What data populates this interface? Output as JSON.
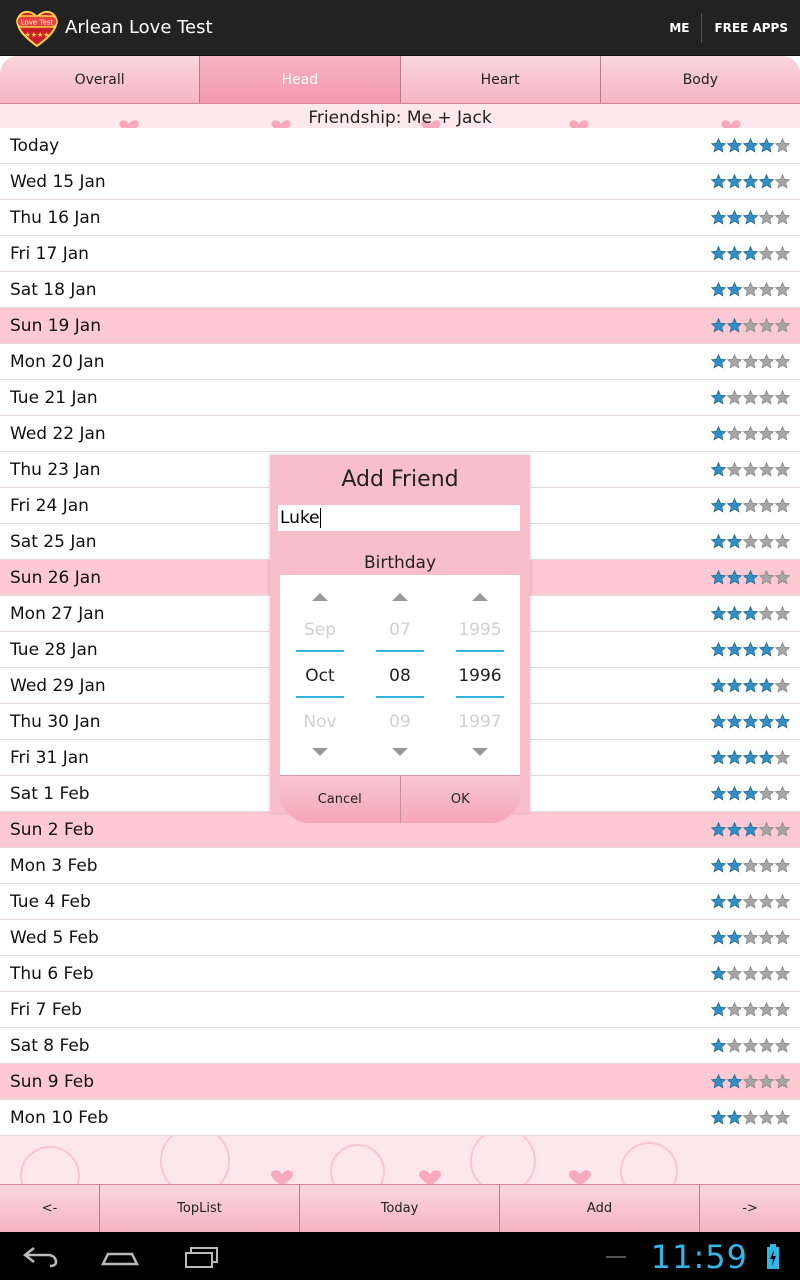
{
  "app": {
    "title": "Arlean Love Test",
    "logo_text": "Love Test",
    "actions": [
      "ME",
      "FREE APPS"
    ]
  },
  "tabs": [
    {
      "label": "Overall",
      "active": false
    },
    {
      "label": "Head",
      "active": true
    },
    {
      "label": "Heart",
      "active": false
    },
    {
      "label": "Body",
      "active": false
    }
  ],
  "banner": {
    "text": "Friendship: Me + Jack"
  },
  "rows": [
    {
      "date": "Today",
      "stars": 4,
      "weekend": false
    },
    {
      "date": "Wed 15 Jan",
      "stars": 4,
      "weekend": false
    },
    {
      "date": "Thu 16 Jan",
      "stars": 3,
      "weekend": false
    },
    {
      "date": "Fri 17 Jan",
      "stars": 3,
      "weekend": false
    },
    {
      "date": "Sat 18 Jan",
      "stars": 2,
      "weekend": false
    },
    {
      "date": "Sun 19 Jan",
      "stars": 2,
      "weekend": true
    },
    {
      "date": "Mon 20 Jan",
      "stars": 1,
      "weekend": false
    },
    {
      "date": "Tue 21 Jan",
      "stars": 1,
      "weekend": false
    },
    {
      "date": "Wed 22 Jan",
      "stars": 1,
      "weekend": false
    },
    {
      "date": "Thu 23 Jan",
      "stars": 1,
      "weekend": false
    },
    {
      "date": "Fri 24 Jan",
      "stars": 2,
      "weekend": false
    },
    {
      "date": "Sat 25 Jan",
      "stars": 2,
      "weekend": false
    },
    {
      "date": "Sun 26 Jan",
      "stars": 3,
      "weekend": true
    },
    {
      "date": "Mon 27 Jan",
      "stars": 3,
      "weekend": false
    },
    {
      "date": "Tue 28 Jan",
      "stars": 4,
      "weekend": false
    },
    {
      "date": "Wed 29 Jan",
      "stars": 4,
      "weekend": false
    },
    {
      "date": "Thu 30 Jan",
      "stars": 5,
      "weekend": false
    },
    {
      "date": "Fri 31 Jan",
      "stars": 4,
      "weekend": false
    },
    {
      "date": "Sat 1 Feb",
      "stars": 3,
      "weekend": false
    },
    {
      "date": "Sun 2 Feb",
      "stars": 3,
      "weekend": true
    },
    {
      "date": "Mon 3 Feb",
      "stars": 2,
      "weekend": false
    },
    {
      "date": "Tue 4 Feb",
      "stars": 2,
      "weekend": false
    },
    {
      "date": "Wed 5 Feb",
      "stars": 2,
      "weekend": false
    },
    {
      "date": "Thu 6 Feb",
      "stars": 1,
      "weekend": false
    },
    {
      "date": "Fri 7 Feb",
      "stars": 1,
      "weekend": false
    },
    {
      "date": "Sat 8 Feb",
      "stars": 1,
      "weekend": false
    },
    {
      "date": "Sun 9 Feb",
      "stars": 2,
      "weekend": true
    },
    {
      "date": "Mon 10 Feb",
      "stars": 2,
      "weekend": false
    }
  ],
  "max_stars": 5,
  "bottombar": [
    "<-",
    "TopList",
    "Today",
    "Add",
    "->"
  ],
  "dialog": {
    "title": "Add Friend",
    "name_value": "Luke",
    "birthday_label": "Birthday",
    "columns": [
      {
        "prev": "Sep",
        "current": "Oct",
        "next": "Nov"
      },
      {
        "prev": "07",
        "current": "08",
        "next": "09"
      },
      {
        "prev": "1995",
        "current": "1996",
        "next": "1997"
      }
    ],
    "cancel_label": "Cancel",
    "ok_label": "OK"
  },
  "status": {
    "time": "11:59"
  },
  "colors": {
    "pink": "#f5b5c1",
    "weekend_row": "#ffc9d4",
    "star_filled": "#2f8fc3",
    "star_empty": "#a6a6a6",
    "accent": "#33b5e5"
  }
}
